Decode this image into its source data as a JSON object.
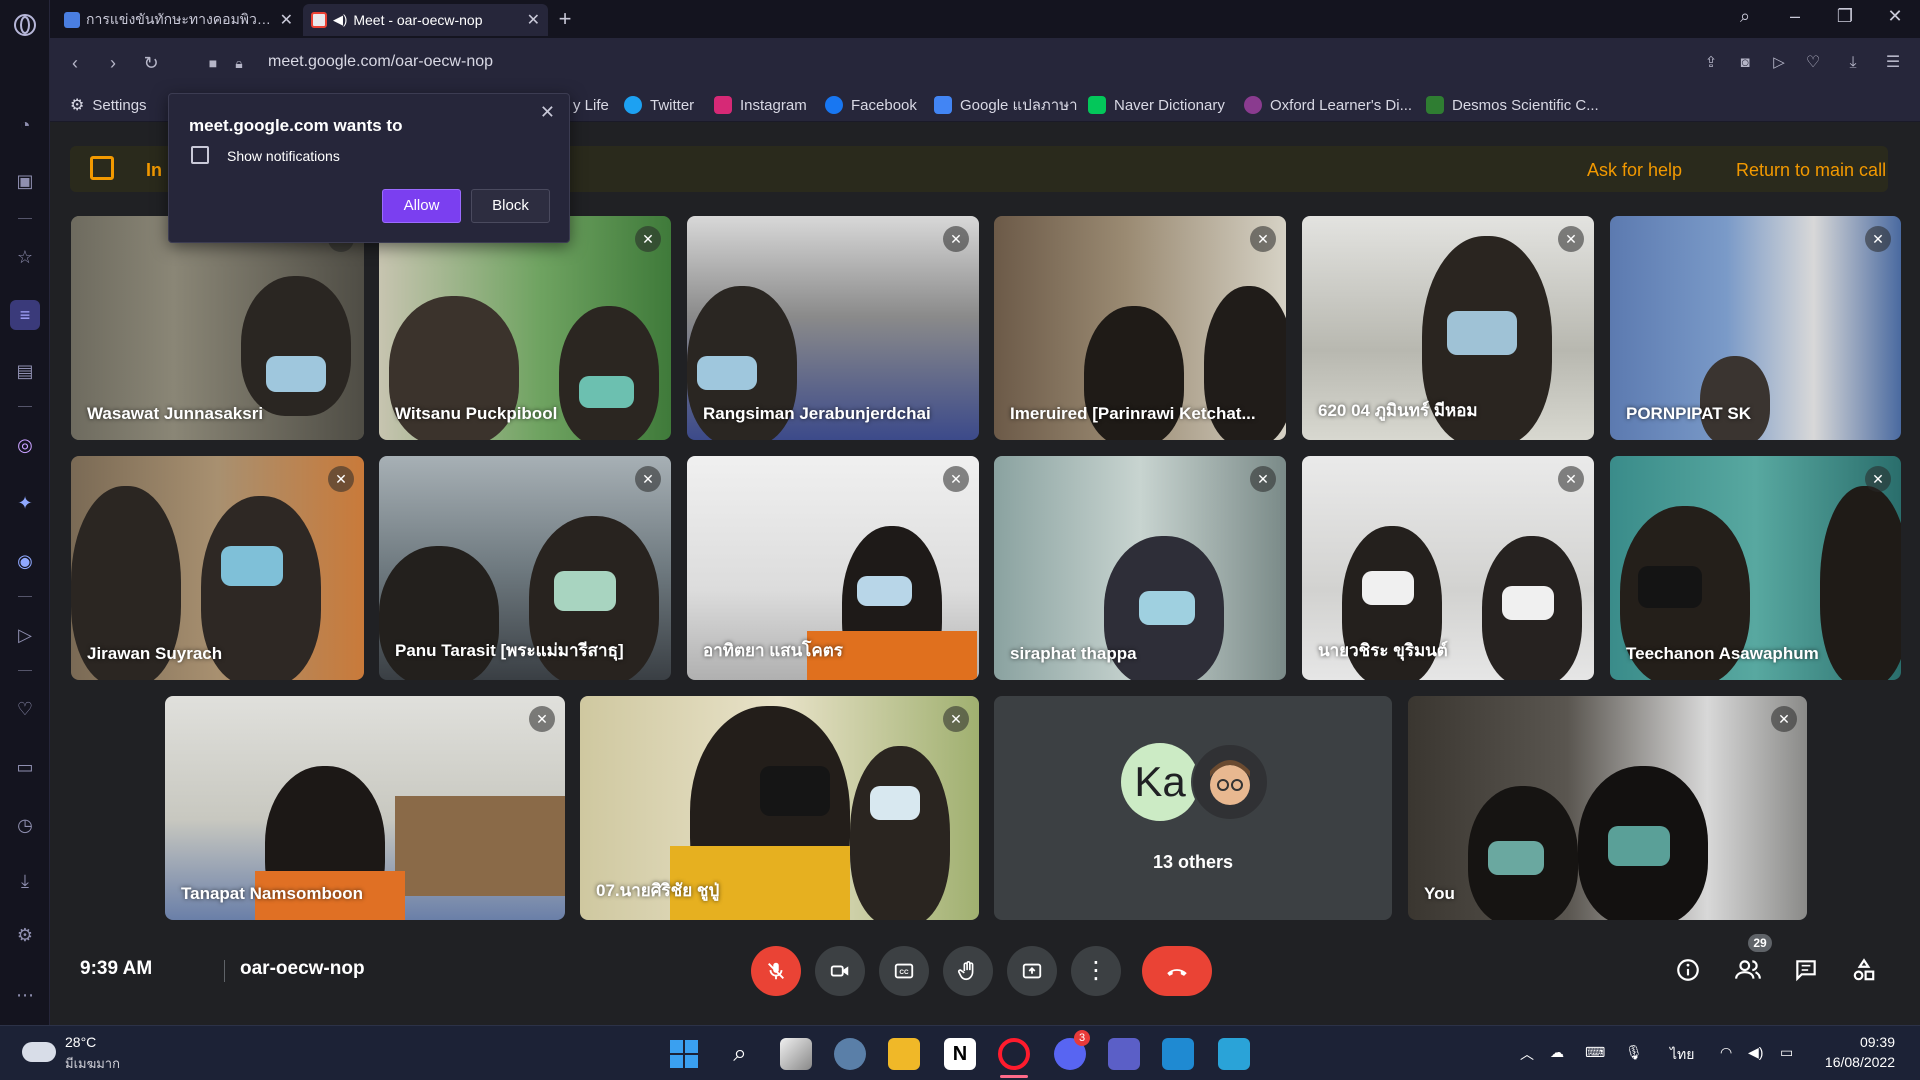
{
  "browser": {
    "tabs": [
      {
        "title": "การแข่งขันทักษะทางคอมพิวเตอ",
        "active": false
      },
      {
        "title": "Meet - oar-oecw-nop",
        "active": true
      }
    ],
    "url": "meet.google.com/oar-oecw-nop",
    "bookmarks": [
      {
        "label": "Settings",
        "icon": "gear-icon"
      },
      {
        "label": "y Life",
        "icon": "none"
      },
      {
        "label": "Twitter",
        "icon": "twitter-icon"
      },
      {
        "label": "Instagram",
        "icon": "instagram-icon"
      },
      {
        "label": "Facebook",
        "icon": "facebook-icon"
      },
      {
        "label": "Google แปลภาษา",
        "icon": "translate-icon"
      },
      {
        "label": "Naver Dictionary",
        "icon": "naver-icon"
      },
      {
        "label": "Oxford Learner's Di...",
        "icon": "oxford-icon"
      },
      {
        "label": "Desmos Scientific C...",
        "icon": "desmos-icon"
      }
    ]
  },
  "popup": {
    "title": "meet.google.com wants to",
    "permission": "Show notifications",
    "allow": "Allow",
    "block": "Block"
  },
  "breakout": {
    "label": "In",
    "ask_help": "Ask for help",
    "return_main": "Return to main call"
  },
  "participants": [
    "Wasawat Junnasaksri",
    "Witsanu Puckpibool",
    "Rangsiman Jerabunjerdchai",
    "Imeruired [Parinrawi Ketchat...",
    "620 04 ภูมินทร์ มีหอม",
    "PORNPIPAT SK",
    "Jirawan Suyrach",
    "Panu Tarasit [พระแม่มารีสาธุ]",
    "อาทิตยา แสนโคตร",
    "siraphat thappa",
    "นายวชิระ ขุริมนต์",
    "Teechanon Asawaphum",
    "Tanapat Namsomboon",
    "07.นายศิริชัย ชูปู่",
    "You"
  ],
  "others": {
    "initials": "Ka",
    "label": "13 others"
  },
  "bottom": {
    "time": "9:39 AM",
    "meeting_code": "oar-oecw-nop",
    "participant_count": "29"
  },
  "taskbar": {
    "weather_temp": "28°C",
    "weather_desc": "มีเมฆมาก",
    "lang": "ไทย",
    "time": "09:39",
    "date": "16/08/2022",
    "discord_badge": "3"
  },
  "colors": {
    "meet_bg": "#202124",
    "accent_orange": "#f29900",
    "hangup_red": "#ea4335",
    "opera_purple": "#7b3ff0"
  }
}
